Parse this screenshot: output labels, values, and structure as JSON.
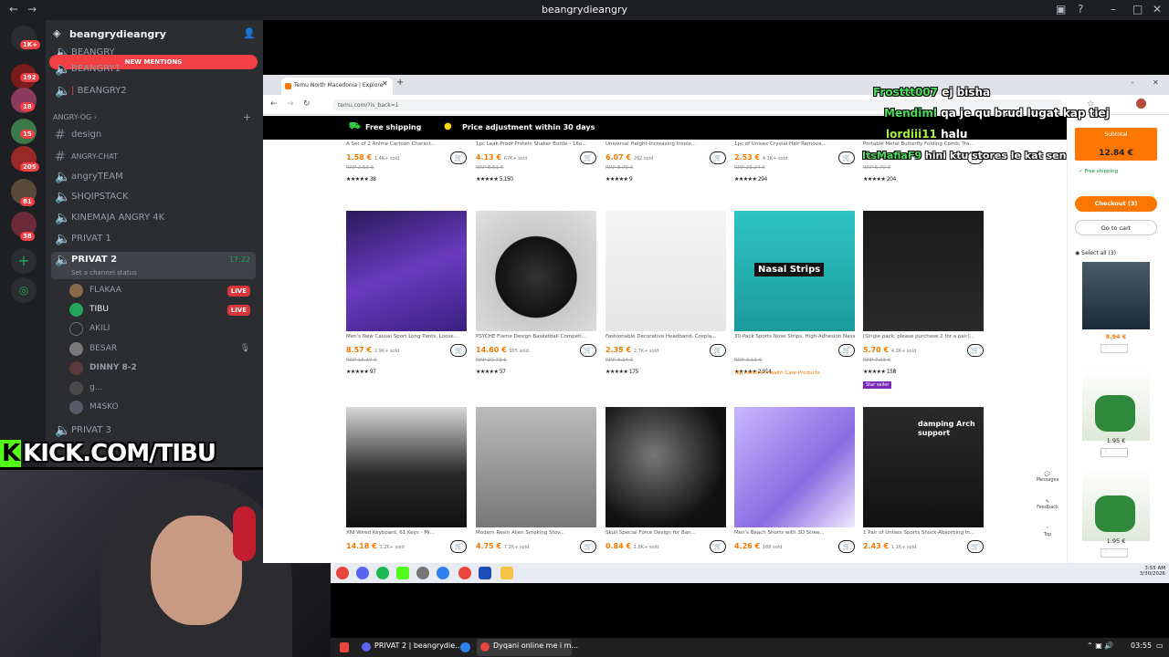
{
  "discord": {
    "window_title": "beangrydieangry",
    "server_name": "beangrydieangry",
    "new_mentions": "NEW MENTIONS",
    "voice_top": [
      "BEANGRY",
      "BEANGRY1",
      "BEANGRY2"
    ],
    "category": "ANGRY-OG",
    "channels": [
      "design",
      "ANGRY-CHAT",
      "angryTEAM",
      "SHQIPSTACK",
      "KINEMAJA ANGRY 4K",
      "PRIVAT 1"
    ],
    "active_channel": {
      "name": "PRIVAT 2",
      "time": "17:22",
      "status": "Set a channel status"
    },
    "users": [
      {
        "name": "FLAKAA",
        "live": "LIVE"
      },
      {
        "name": "TIBU",
        "live": "LIVE"
      },
      {
        "name": "AKILI",
        "live": ""
      },
      {
        "name": "BESAR",
        "live": ""
      },
      {
        "name": "DINNY 8-2",
        "live": ""
      },
      {
        "name": "g...",
        "live": ""
      },
      {
        "name": "M4SKO",
        "live": ""
      }
    ],
    "channel_after": "PRIVAT 3",
    "guild_badges": [
      "1K+",
      "192",
      "18",
      "15",
      "205",
      "81",
      "38"
    ]
  },
  "overlay": {
    "kick_url": "KICK.COM/TIBU"
  },
  "chat_messages": [
    {
      "user": "Frosttt007",
      "text": "ej bisha",
      "color": "#4ade5c"
    },
    {
      "user": "Mendiml",
      "text": "qa je qu brud lugat kap tiej",
      "color": "#4ade5c"
    },
    {
      "user": "lordiii11",
      "text": "halu",
      "color": "#a7f03c"
    },
    {
      "user": "ItsMafiaF9",
      "text": "hini ktu stores le kat sen",
      "color": "#4ade5c"
    }
  ],
  "browser": {
    "tab_title": "Temu North Macedonia | Explore",
    "url": "temu.com/?is_back=1",
    "promo_shipping": "Free shipping",
    "promo_price": "Price adjustment within 30 days",
    "top_row": [
      {
        "title": "A Set of 2 Anime Cartoon Charact...",
        "price": "1.58 €",
        "sold": "1.4K+ sold",
        "rrp": "RRP 2.53 €",
        "rating": "38"
      },
      {
        "title": "1pc Leak-Proof Protein Shaker Bottle - 16o...",
        "price": "4.13 €",
        "sold": "67K+ sold",
        "rrp": "RRP 8.61 €",
        "rating": "5,150"
      },
      {
        "title": "Universal Height-Increasing Insole...",
        "price": "6.07 €",
        "sold": "262 sold",
        "rrp": "RRP 8.79 €",
        "rating": "9"
      },
      {
        "title": "1pc of Unisex Crystal Hair Remova...",
        "price": "2.53 €",
        "sold": "4.1K+ sold",
        "rrp": "RRP 28.24 €",
        "rating": "294"
      },
      {
        "title": "Portable Metal Butterfly Folding Comb, Tra...",
        "price": "1.30 €",
        "sold": "",
        "rrp": "RRP 6.70 €",
        "rating": "204"
      }
    ],
    "mid_row": [
      {
        "title": "Men's New Casual Sport Long Pants, Loose...",
        "price": "8.57 €",
        "sold": "2.9K+ sold",
        "rrp": "RRP 15.17 €",
        "rating": "97",
        "img": "pants"
      },
      {
        "title": "PSYCHE Flame Design Basketball Competi...",
        "price": "14.60 €",
        "sold": "905 sold",
        "rrp": "RRP 20.73 €",
        "rating": "57",
        "img": "ball"
      },
      {
        "title": "Fashionable Decorative Headband, Cospla...",
        "price": "2.35 €",
        "sold": "2.7K+ sold",
        "rrp": "RRP 3.14 €",
        "rating": "175",
        "img": "hair"
      },
      {
        "title": "30-Pack Sports Nose Strips, High-Adhesion Nasal Strips",
        "price": "",
        "sold": "",
        "rrp": "RRP 3.11 €",
        "rating": "2,914",
        "img": "nasal"
      },
      {
        "title": "[Single pack, please purchase 2 for a pair]...",
        "price": "5.70 €",
        "sold": "4.3K+ sold",
        "rrp": "RRP 7.03 €",
        "rating": "158",
        "img": "wood"
      }
    ],
    "nasal_label": "Nasal Strips",
    "health_tag": "Top Rated in Health Care Products",
    "star_seller": "Star seller",
    "bottom_row": [
      {
        "title": "XNI Wired Keyboard, 61 Keys - Mi...",
        "price": "14.18 €",
        "sold": "1.2K+ sold",
        "img": "kbd"
      },
      {
        "title": "Modern Resin Alien Smoking Stov...",
        "price": "4.75 €",
        "sold": "7.2K+ sold",
        "img": "alien"
      },
      {
        "title": "Skull Special Force Design for Ban...",
        "price": "0.84 €",
        "sold": "1.8K+ sold",
        "img": "skull"
      },
      {
        "title": "Men's Beach Shorts with 3D Stree...",
        "price": "4.26 €",
        "sold": "188 sold",
        "img": "shorts"
      },
      {
        "title": "1 Pair of Unisex Sports Shock-Absorbing In...",
        "price": "2.43 €",
        "sold": "1.1K+ sold",
        "img": "insole"
      }
    ],
    "insole_text": "damping Arch support",
    "cart_panel": {
      "subtotal_label": "Subtotal",
      "subtotal": "12.84 €",
      "free_shipping": "Free shipping",
      "checkout": "Checkout (3)",
      "go_to_cart": "Go to cart",
      "select_all": "Select all (3)",
      "items": [
        {
          "price": "8.94 €",
          "qty": "1"
        },
        {
          "price": "1.95 €",
          "qty": "1"
        },
        {
          "price": "1.95 €",
          "qty": "1"
        }
      ],
      "messages": "Messages",
      "feedback": "Feedback",
      "top": "Top"
    },
    "clock_time": "3:55 AM",
    "clock_date": "3/30/2026"
  },
  "taskbar": {
    "items": [
      "PRIVAT 2 | beangrydie...",
      "Dyqani online me i m..."
    ],
    "time": "03:55"
  }
}
